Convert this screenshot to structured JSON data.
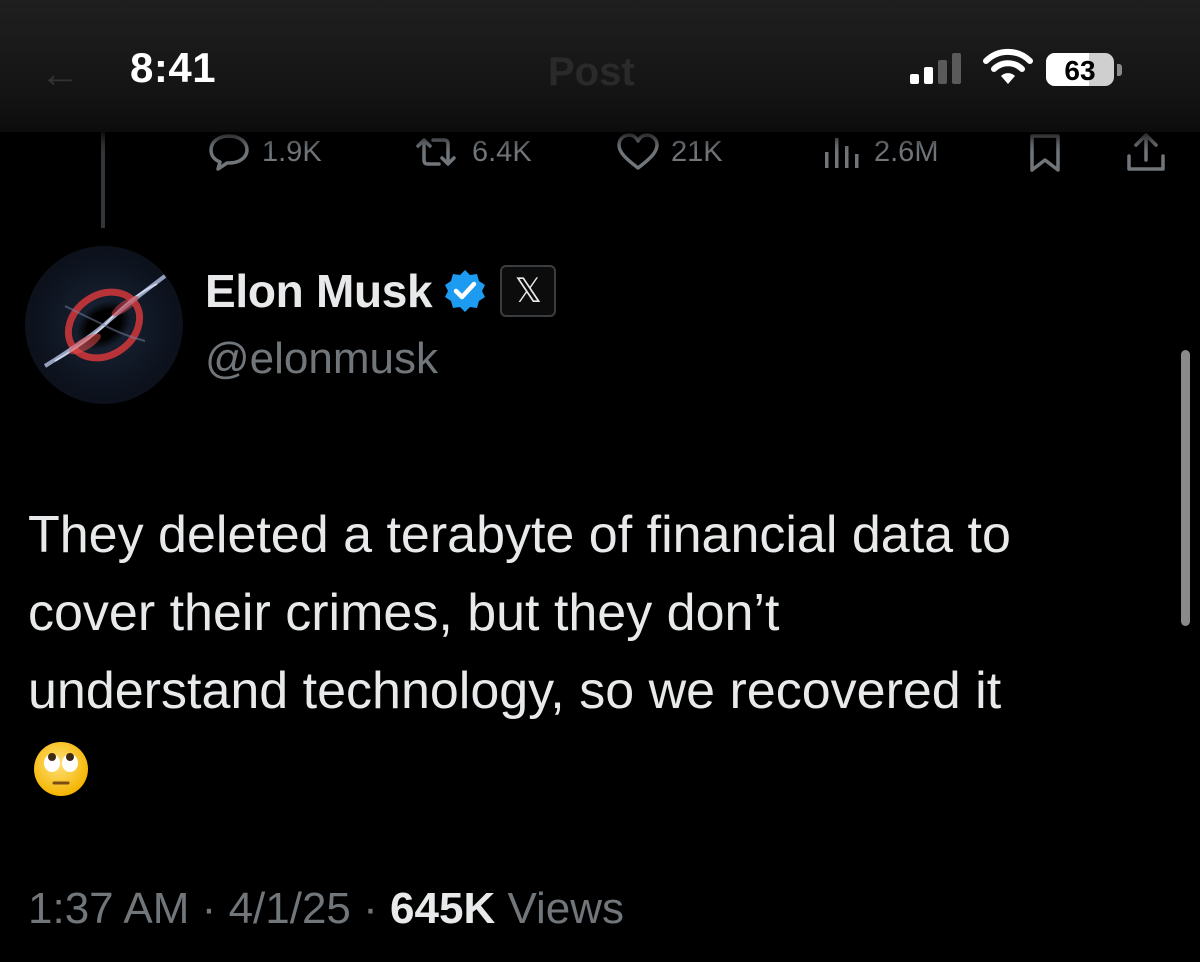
{
  "status_bar": {
    "time": "8:41",
    "battery_level": "63",
    "battery_fraction": 0.63,
    "signal_bars_active": 2,
    "signal_bars_total": 4
  },
  "header": {
    "title": "Post"
  },
  "previous_post_actions": {
    "replies": "1.9K",
    "reposts": "6.4K",
    "likes": "21K",
    "views": "2.6M"
  },
  "post": {
    "author": {
      "name": "Elon Musk",
      "handle": "@elonmusk",
      "verified": true,
      "affiliate_badge": "𝕏"
    },
    "text_lines": [
      "They deleted a terabyte of financial data to",
      "cover their crimes, but they don’t",
      "understand technology, so we recovered it"
    ],
    "emoji": "face-with-rolling-eyes",
    "time": "1:37 AM",
    "separator": "·",
    "date": "4/1/25",
    "views_count": "645K",
    "views_label": "Views"
  },
  "colors": {
    "background": "#000000",
    "primary_text": "#e7e9ea",
    "secondary_text": "#71767b",
    "verified_blue": "#1d9bf0"
  },
  "icons": {
    "reply": "speech-bubble-icon",
    "repost": "repost-arrows-icon",
    "like": "heart-icon",
    "views": "bar-chart-icon",
    "bookmark": "bookmark-icon",
    "share": "share-upload-icon",
    "verified": "verified-badge-icon",
    "signal": "cellular-signal-icon",
    "wifi": "wifi-icon",
    "battery": "battery-icon"
  }
}
